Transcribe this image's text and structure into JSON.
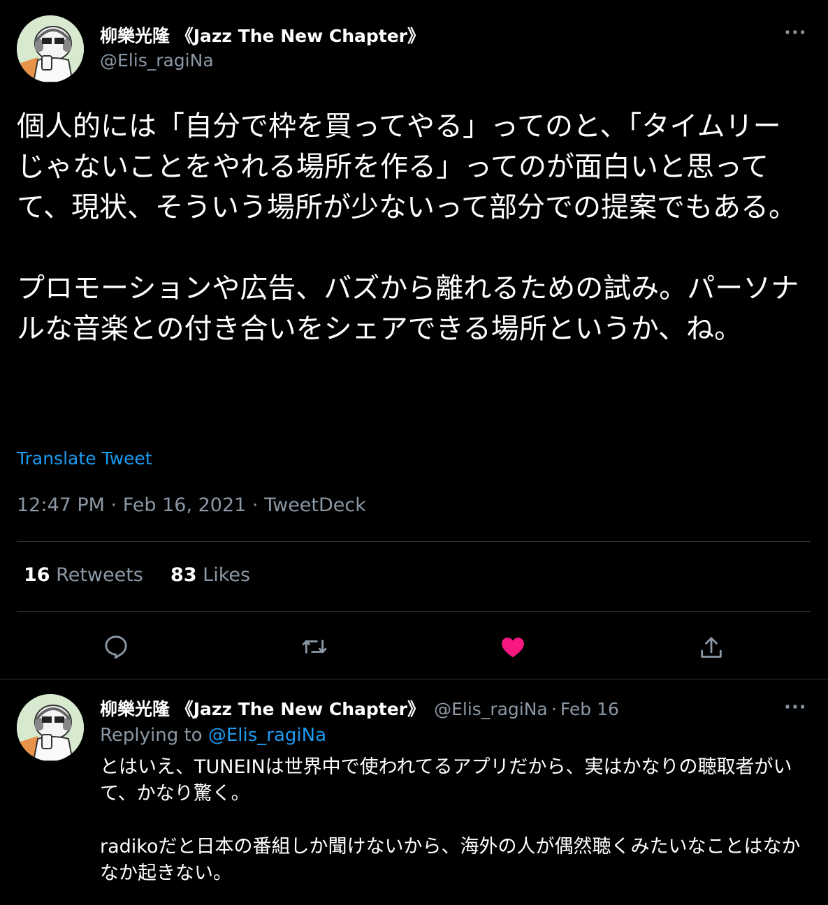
{
  "main_tweet": {
    "author_name": "柳樂光隆 《Jazz The New Chapter》",
    "author_handle": "@Elis_ragiNa",
    "more_label": "···",
    "text": "個人的には「自分で枠を買ってやる」ってのと、「タイムリーじゃないことをやれる場所を作る」ってのが面白いと思ってて、現状、そういう場所が少ないって部分での提案でもある。\n\nプロモーションや広告、バズから離れるための試み。パーソナルな音楽との付き合いをシェアできる場所というか、ね。",
    "translate_label": "Translate Tweet",
    "timestamp": "12:47 PM · Feb 16, 2021 · TweetDeck",
    "retweets_count": "16",
    "retweets_label": "Retweets",
    "likes_count": "83",
    "likes_label": "Likes",
    "liked": true,
    "colors": {
      "accent": "#1d9bf0",
      "like": "#f91880",
      "muted": "#8b98a5"
    },
    "actions": [
      {
        "icon": "reply-icon"
      },
      {
        "icon": "retweet-icon"
      },
      {
        "icon": "heart-icon"
      },
      {
        "icon": "share-icon"
      }
    ]
  },
  "reply_tweet": {
    "author_name": "柳樂光隆 《Jazz The New Chapter》",
    "author_handle": "@Elis_ragiNa",
    "separator": "·",
    "date": "Feb 16",
    "more_label": "···",
    "replying_to_label": "Replying to",
    "replying_to_handle": "@Elis_ragiNa",
    "text": "とはいえ、TUNEINは世界中で使われてるアプリだから、実はかなりの聴取者がいて、かなり驚く。\n\nradikoだと日本の番組しか聞けないから、海外の人が偶然聴くみたいなことはなかなか起きない。"
  }
}
